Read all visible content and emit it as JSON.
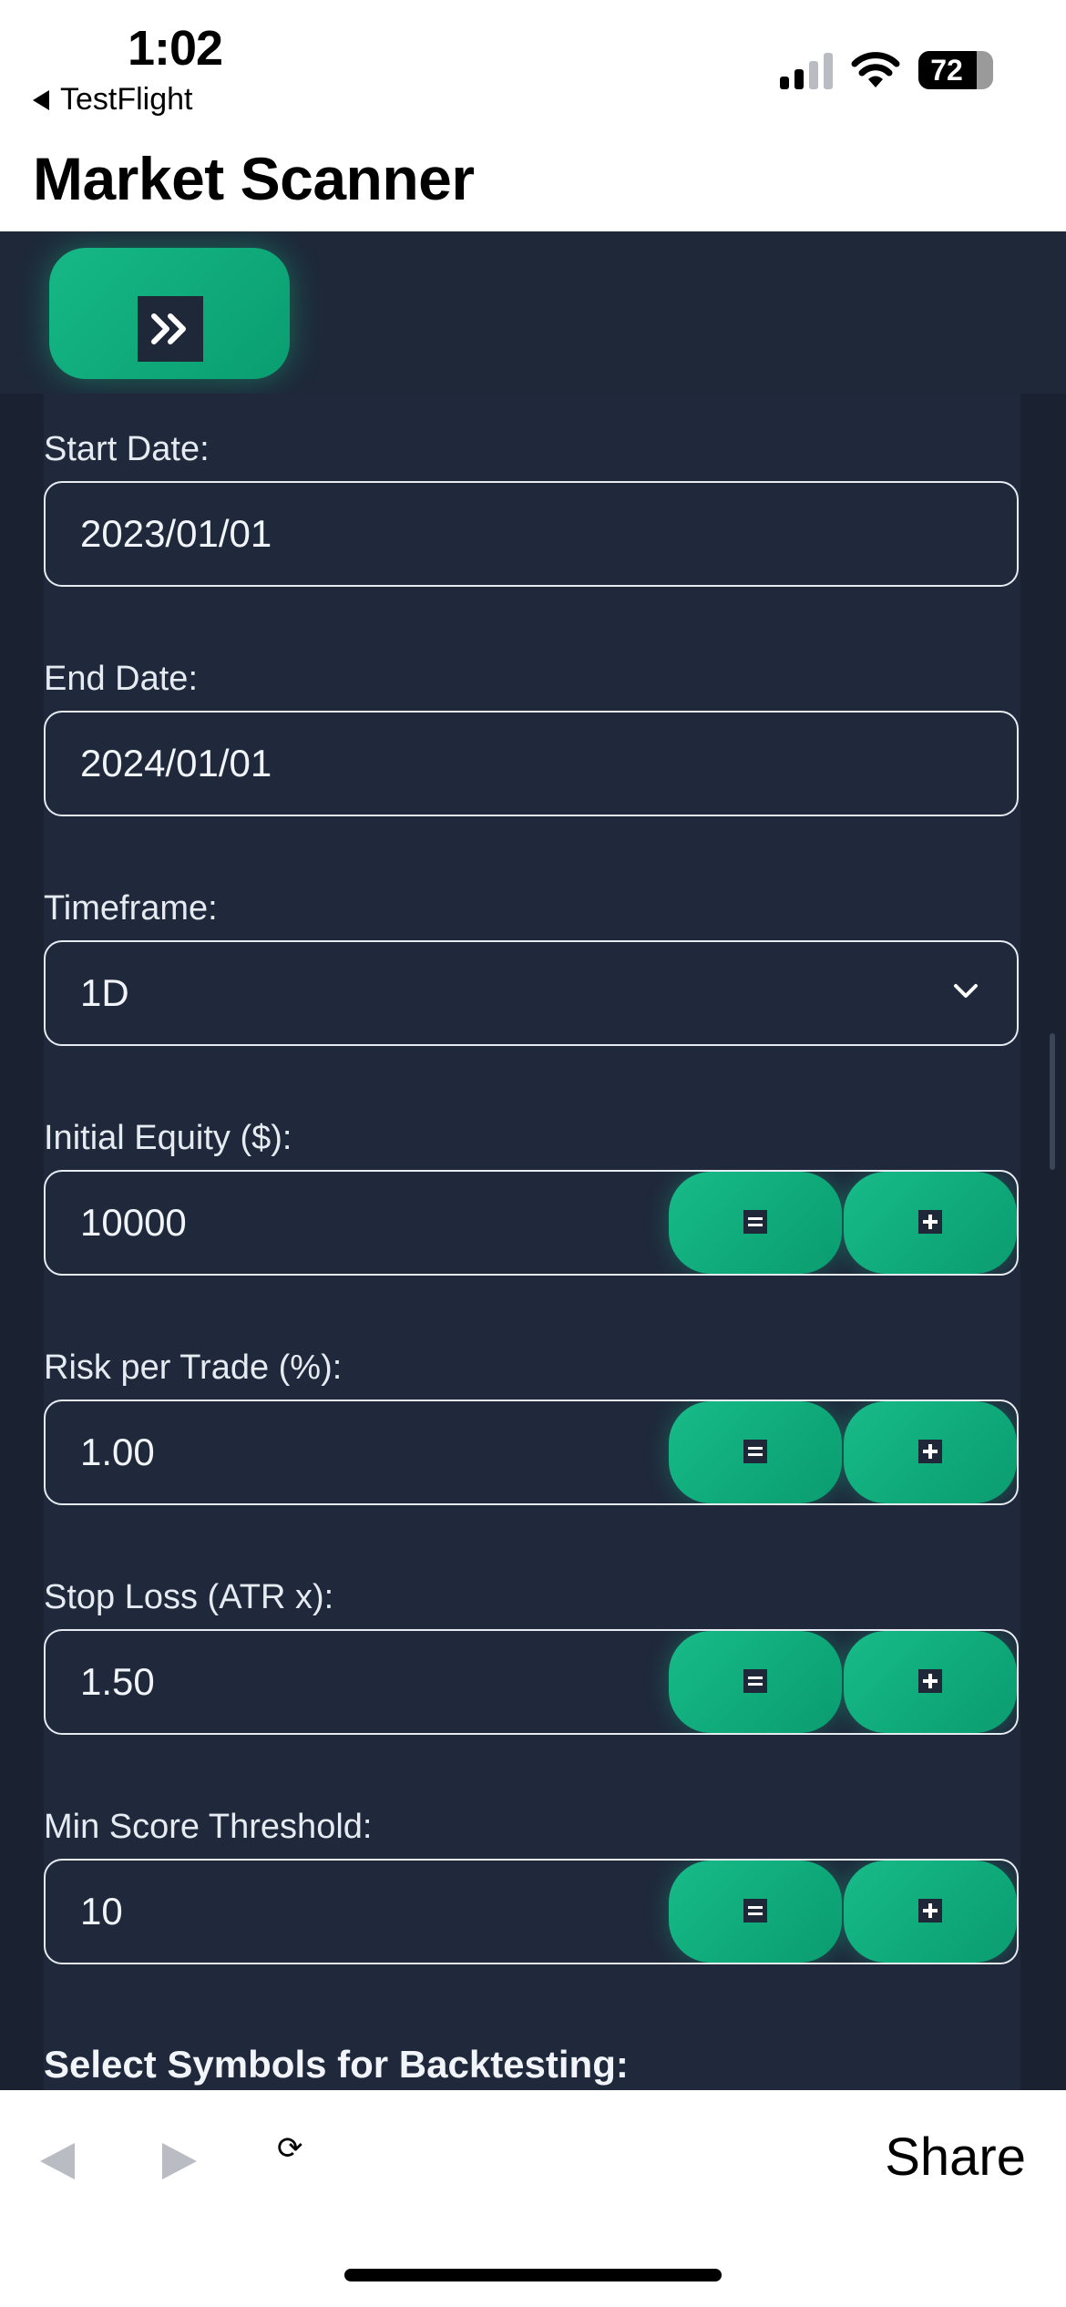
{
  "status_bar": {
    "time": "1:02",
    "back_app": "TestFlight",
    "battery_level": "72",
    "icons": [
      "cellular-signal-icon",
      "wifi-icon",
      "battery-icon"
    ]
  },
  "header": {
    "title": "Market Scanner"
  },
  "toolbar": {
    "expand_icon": "double-chevron-right-icon"
  },
  "form": {
    "start_date": {
      "label": "Start Date:",
      "value": "2023/01/01"
    },
    "end_date": {
      "label": "End Date:",
      "value": "2024/01/01"
    },
    "timeframe": {
      "label": "Timeframe:",
      "value": "1D",
      "icon": "chevron-down-icon"
    },
    "initial_equity": {
      "label": "Initial Equity ($):",
      "value": "10000"
    },
    "risk_per_trade": {
      "label": "Risk per Trade (%):",
      "value": "1.00"
    },
    "stop_loss": {
      "label": "Stop Loss (ATR x):",
      "value": "1.50"
    },
    "min_score": {
      "label": "Min Score Threshold:",
      "value": "10"
    },
    "symbols_heading": "Select Symbols for Backtesting:"
  },
  "bottom_bar": {
    "share_label": "Share",
    "reload_glyph": "⟳"
  },
  "colors": {
    "accent": "#16b886",
    "background": "#1a2232",
    "panel": "#1f293b",
    "text": "#e6ebf2"
  }
}
